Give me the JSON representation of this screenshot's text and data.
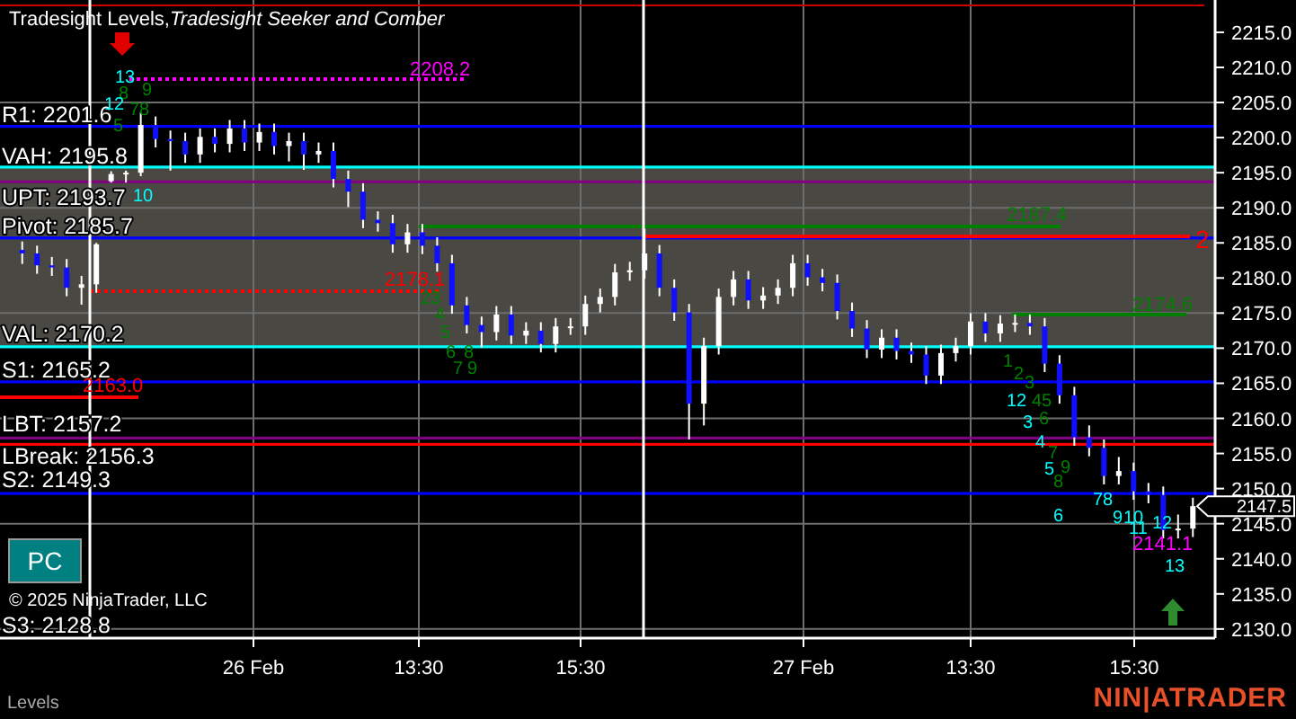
{
  "chart_title": "Tradesight Levels,*Tradesight Seeker and Comber*",
  "levels": [
    {
      "label": "R1: 2201.6",
      "color": "#0000ff"
    },
    {
      "label": "VAH: 2195.8",
      "color": "#00ffff"
    },
    {
      "label": "UPT: 2193.7",
      "color": "#800080"
    },
    {
      "label": "Pivot: 2185.7",
      "color": "#0000ff"
    },
    {
      "label": "VAL: 2170.2",
      "color": "#00ffff"
    },
    {
      "label": "S1: 2165.2",
      "color": "#0000ff"
    },
    {
      "label": "LBT: 2157.2",
      "color": "#800080"
    },
    {
      "label": "LBreak: 2156.3",
      "color": "#ff0000"
    },
    {
      "label": "S2: 2149.3",
      "color": "#0000ff"
    },
    {
      "label": "S3: 2128.8"
    }
  ],
  "price_labels": [
    {
      "text": "2208.2",
      "color": "#ff00ff",
      "kind": "dotted"
    },
    {
      "text": "2178.1",
      "color": "#ff0000",
      "kind": "dotted"
    },
    {
      "text": "2163.0",
      "color": "#ff0000",
      "kind": "solid"
    },
    {
      "text": "2187.4",
      "color": "#008000",
      "kind": "solid"
    },
    {
      "text": "2174.6",
      "color": "#008000",
      "kind": "solid"
    },
    {
      "text": "2141.1",
      "color": "#ff00ff",
      "kind": "none"
    },
    {
      "text": "2",
      "color": "#ff0000",
      "kind": "solid"
    }
  ],
  "counts": [
    {
      "text": "13",
      "color": "#00ffff"
    },
    {
      "text": "8",
      "color": "#008000"
    },
    {
      "text": "9",
      "color": "#008000"
    },
    {
      "text": "12",
      "color": "#00ffff"
    },
    {
      "text": "78",
      "color": "#008000"
    },
    {
      "text": "5",
      "color": "#008000"
    },
    {
      "text": "10",
      "color": "#00ffff"
    },
    {
      "text": "23",
      "color": "#008000"
    },
    {
      "text": "4",
      "color": "#008000"
    },
    {
      "text": "5",
      "color": "#008000"
    },
    {
      "text": "6",
      "color": "#008000"
    },
    {
      "text": "8",
      "color": "#008000"
    },
    {
      "text": "7",
      "color": "#008000"
    },
    {
      "text": "9",
      "color": "#008000"
    },
    {
      "text": "1",
      "color": "#008000"
    },
    {
      "text": "2",
      "color": "#008000"
    },
    {
      "text": "3",
      "color": "#008000"
    },
    {
      "text": "12",
      "color": "#00ffff"
    },
    {
      "text": "45",
      "color": "#008000"
    },
    {
      "text": "3",
      "color": "#00ffff"
    },
    {
      "text": "6",
      "color": "#008000"
    },
    {
      "text": "4",
      "color": "#00ffff"
    },
    {
      "text": "7",
      "color": "#008000"
    },
    {
      "text": "9",
      "color": "#008000"
    },
    {
      "text": "8",
      "color": "#008000"
    },
    {
      "text": "5",
      "color": "#00ffff"
    },
    {
      "text": "6",
      "color": "#00ffff"
    },
    {
      "text": "78",
      "color": "#00ffff"
    },
    {
      "text": "9",
      "color": "#00ffff"
    },
    {
      "text": "10",
      "color": "#00ffff"
    },
    {
      "text": "11",
      "color": "#00ffff"
    },
    {
      "text": "12",
      "color": "#00ffff"
    },
    {
      "text": "13",
      "color": "#00ffff"
    }
  ],
  "chart_data": {
    "type": "candlestick",
    "categories": [
      null,
      null,
      null,
      null,
      null,
      null,
      null,
      null,
      null,
      null,
      null,
      null,
      null,
      null,
      null,
      null,
      null,
      null,
      null,
      null,
      null,
      null,
      null,
      null,
      null,
      null,
      null,
      null,
      null,
      null,
      null,
      null,
      null,
      null,
      null,
      null,
      null,
      null,
      null,
      null,
      null,
      null,
      null,
      null,
      null,
      null,
      null,
      null,
      null,
      null,
      null,
      null,
      null,
      null,
      null,
      null,
      null,
      null,
      null,
      null,
      null,
      null,
      null,
      null,
      null,
      null,
      null,
      null,
      null,
      null,
      null,
      null,
      null,
      null,
      null,
      null,
      null,
      null,
      null,
      null
    ],
    "ohlc": [
      [
        2184.0,
        2185.2,
        2182.0,
        2183.5
      ],
      [
        2183.5,
        2184.6,
        2180.6,
        2181.8
      ],
      [
        2181.8,
        2183.0,
        2180.3,
        2181.5
      ],
      [
        2181.5,
        2182.7,
        2177.4,
        2178.6
      ],
      [
        2178.6,
        2180.3,
        2176.2,
        2179.1
      ],
      [
        2179.1,
        2185.0,
        2177.9,
        2184.8
      ],
      [
        2193.8,
        2195.2,
        2193.6,
        2194.8
      ],
      [
        2194.8,
        2195.3,
        2193.6,
        2195.0
      ],
      [
        2195.0,
        2203.6,
        2194.5,
        2201.8
      ],
      [
        2201.8,
        2203.0,
        2198.6,
        2199.8
      ],
      [
        2199.8,
        2201.0,
        2195.3,
        2199.5
      ],
      [
        2199.5,
        2200.7,
        2196.4,
        2197.6
      ],
      [
        2197.6,
        2201.3,
        2196.4,
        2200.1
      ],
      [
        2200.1,
        2201.3,
        2197.9,
        2199.1
      ],
      [
        2199.1,
        2202.5,
        2197.9,
        2201.3
      ],
      [
        2201.3,
        2202.5,
        2198.1,
        2199.3
      ],
      [
        2199.3,
        2202.0,
        2198.1,
        2200.8
      ],
      [
        2200.8,
        2202.0,
        2197.6,
        2198.8
      ],
      [
        2198.8,
        2200.7,
        2196.6,
        2199.5
      ],
      [
        2199.5,
        2200.7,
        2195.4,
        2197.6
      ],
      [
        2197.6,
        2199.3,
        2196.4,
        2198.1
      ],
      [
        2198.1,
        2199.3,
        2192.9,
        2194.1
      ],
      [
        2194.1,
        2195.3,
        2190.1,
        2192.3
      ],
      [
        2192.3,
        2193.5,
        2187.1,
        2188.3
      ],
      [
        2188.3,
        2189.5,
        2186.6,
        2187.8
      ],
      [
        2187.8,
        2189.0,
        2183.6,
        2184.8
      ],
      [
        2184.8,
        2187.7,
        2183.6,
        2186.5
      ],
      [
        2186.5,
        2187.7,
        2183.4,
        2184.6
      ],
      [
        2184.6,
        2185.8,
        2180.9,
        2182.1
      ],
      [
        2182.1,
        2183.3,
        2174.9,
        2176.1
      ],
      [
        2176.1,
        2177.3,
        2172.1,
        2173.3
      ],
      [
        2173.3,
        2174.5,
        2170.1,
        2172.3
      ],
      [
        2172.3,
        2176.0,
        2171.1,
        2174.8
      ],
      [
        2174.8,
        2176.0,
        2170.6,
        2171.8
      ],
      [
        2171.8,
        2173.7,
        2170.6,
        2172.5
      ],
      [
        2172.5,
        2173.7,
        2169.4,
        2170.6
      ],
      [
        2170.6,
        2174.3,
        2169.4,
        2173.1
      ],
      [
        2173.1,
        2174.3,
        2171.9,
        2173.1
      ],
      [
        2173.1,
        2177.5,
        2171.9,
        2176.3
      ],
      [
        2176.3,
        2178.5,
        2175.1,
        2177.3
      ],
      [
        2177.3,
        2182.0,
        2176.1,
        2180.8
      ],
      [
        2180.8,
        2182.3,
        2179.6,
        2181.1
      ],
      [
        2181.1,
        2187.0,
        2179.9,
        2183.5
      ],
      [
        2183.5,
        2184.7,
        2177.4,
        2178.6
      ],
      [
        2178.6,
        2179.8,
        2173.9,
        2175.1
      ],
      [
        2175.1,
        2176.3,
        2157.0,
        2162.1
      ],
      [
        2162.1,
        2171.5,
        2159.0,
        2170.3
      ],
      [
        2170.3,
        2178.5,
        2169.1,
        2177.3
      ],
      [
        2177.3,
        2181.0,
        2176.1,
        2179.8
      ],
      [
        2179.8,
        2181.0,
        2175.6,
        2176.8
      ],
      [
        2176.8,
        2178.7,
        2175.6,
        2177.5
      ],
      [
        2177.5,
        2179.8,
        2176.3,
        2178.6
      ],
      [
        2178.6,
        2183.3,
        2177.4,
        2182.1
      ],
      [
        2182.1,
        2183.3,
        2178.9,
        2180.1
      ],
      [
        2180.1,
        2181.3,
        2178.1,
        2179.3
      ],
      [
        2179.3,
        2180.5,
        2174.1,
        2175.3
      ],
      [
        2175.3,
        2176.5,
        2171.6,
        2172.8
      ],
      [
        2172.8,
        2174.0,
        2168.6,
        2169.8
      ],
      [
        2169.8,
        2172.7,
        2168.6,
        2171.5
      ],
      [
        2171.5,
        2172.7,
        2168.4,
        2169.6
      ],
      [
        2169.6,
        2170.8,
        2167.9,
        2169.1
      ],
      [
        2169.1,
        2170.3,
        2164.9,
        2166.1
      ],
      [
        2166.1,
        2170.5,
        2164.9,
        2169.3
      ],
      [
        2169.3,
        2171.5,
        2168.1,
        2170.3
      ],
      [
        2170.3,
        2175.0,
        2169.1,
        2173.8
      ],
      [
        2173.8,
        2175.0,
        2170.9,
        2172.1
      ],
      [
        2172.1,
        2174.7,
        2170.9,
        2173.5
      ],
      [
        2173.5,
        2174.8,
        2172.3,
        2173.6
      ],
      [
        2173.6,
        2174.8,
        2171.9,
        2173.1
      ],
      [
        2173.1,
        2174.3,
        2166.6,
        2167.8
      ],
      [
        2167.8,
        2169.0,
        2162.1,
        2163.3
      ],
      [
        2163.3,
        2164.5,
        2156.1,
        2157.3
      ],
      [
        2157.3,
        2159.0,
        2154.6,
        2155.8
      ],
      [
        2155.8,
        2157.0,
        2150.6,
        2151.8
      ],
      [
        2151.8,
        2154.5,
        2150.6,
        2152.5
      ],
      [
        2152.5,
        2153.7,
        2148.4,
        2149.6
      ],
      [
        2149.6,
        2150.8,
        2147.9,
        2149.1
      ],
      [
        2149.1,
        2150.3,
        2142.9,
        2144.1
      ],
      [
        2144.1,
        2146.3,
        2142.9,
        2144.3
      ],
      [
        2144.3,
        2148.7,
        2143.1,
        2147.5
      ]
    ],
    "ylim": [
      2128.7,
      2219.6
    ],
    "yticks": [
      {
        "value": 2215,
        "label": "2215.0"
      },
      {
        "value": 2210,
        "label": "2210.0"
      },
      {
        "value": 2205,
        "label": "2205.0"
      },
      {
        "value": 2200,
        "label": "2200.0"
      },
      {
        "value": 2195,
        "label": "2195.0"
      },
      {
        "value": 2190,
        "label": "2190.0"
      },
      {
        "value": 2185,
        "label": "2185.0"
      },
      {
        "value": 2180,
        "label": "2180.0"
      },
      {
        "value": 2175,
        "label": "2175.0"
      },
      {
        "value": 2170,
        "label": "2170.0"
      },
      {
        "value": 2165,
        "label": "2165.0"
      },
      {
        "value": 2160,
        "label": "2160.0"
      },
      {
        "value": 2155,
        "label": "2155.0"
      },
      {
        "value": 2150,
        "label": "2150.0"
      },
      {
        "value": 2145,
        "label": "2145.0"
      },
      {
        "value": 2140,
        "label": "2140.0"
      },
      {
        "value": 2135,
        "label": "2135.0"
      },
      {
        "value": 2130,
        "label": "2130.0"
      }
    ]
  },
  "time_axis": [
    "26 Feb",
    "13:30",
    "15:30",
    "27 Feb",
    "13:30",
    "15:30"
  ],
  "current_price": "2147.5",
  "pc_button": "PC",
  "copyright": "© 2025 NinjaTrader, LLC",
  "panel_label": "Levels",
  "logo": "NIN|ATRADER"
}
